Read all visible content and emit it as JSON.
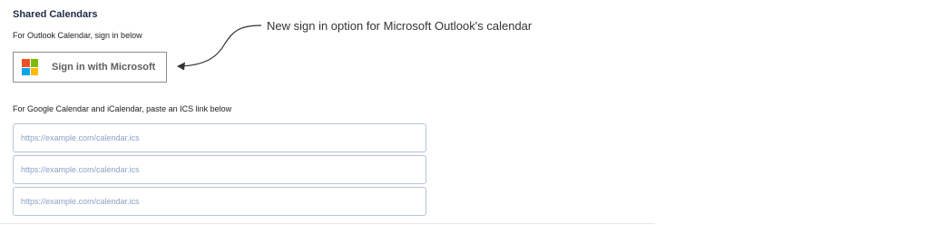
{
  "section": {
    "title": "Shared Calendars",
    "outlook_label": "For Outlook Calendar, sign in below",
    "microsoft_button_label": "Sign in with Microsoft",
    "microsoft_logo_colors": [
      "#f25022",
      "#7fba00",
      "#00a4ef",
      "#ffb900"
    ],
    "google_label": "For Google Calendar and iCalendar, paste an ICS link below",
    "ics_inputs": [
      {
        "value": "",
        "placeholder": "https://example.com/calendar.ics"
      },
      {
        "value": "",
        "placeholder": "https://example.com/calendar.ics"
      },
      {
        "value": "",
        "placeholder": "https://example.com/calendar.ics"
      }
    ]
  },
  "annotation": {
    "text": "New sign in option for Microsoft Outlook's calendar"
  }
}
